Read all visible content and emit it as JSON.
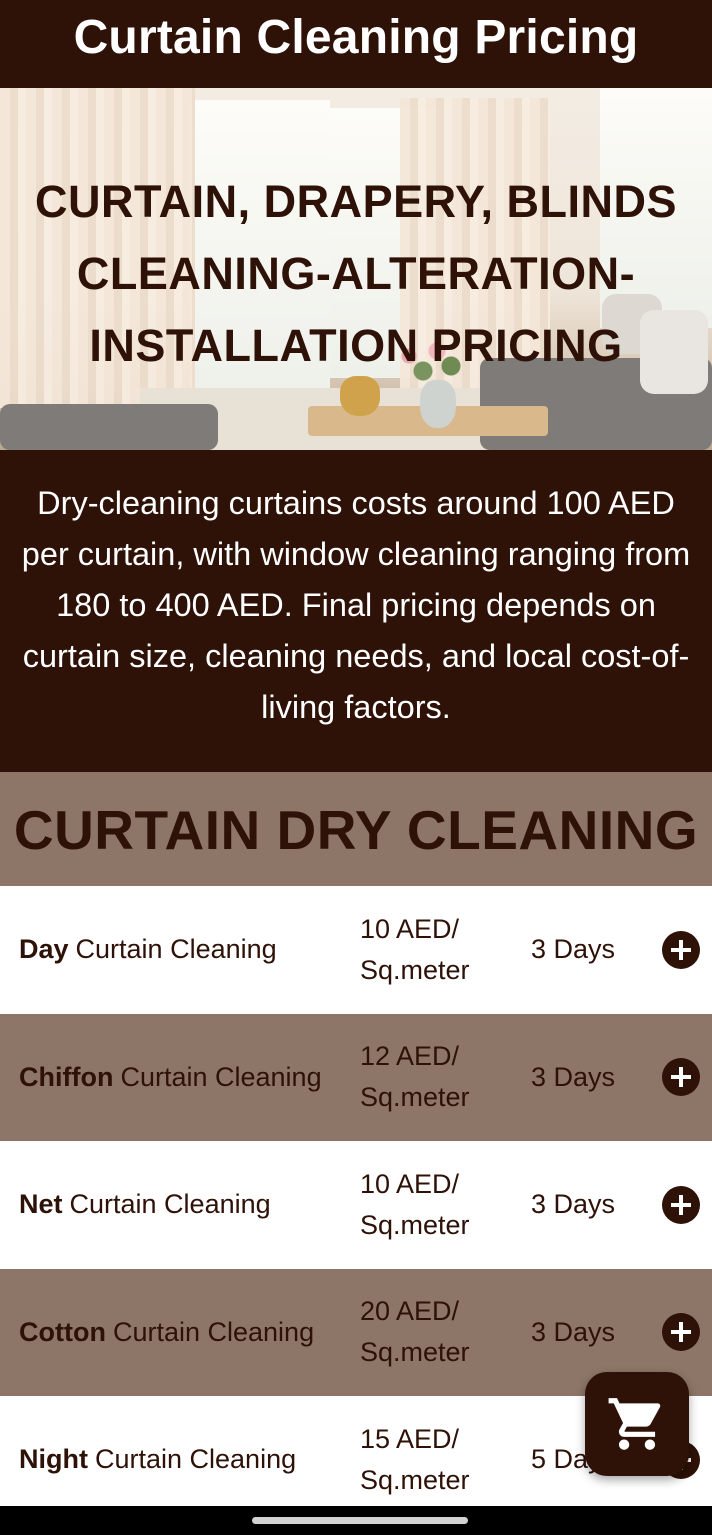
{
  "header": {
    "title": "Curtain Cleaning Pricing"
  },
  "hero": {
    "title": "CURTAIN, DRAPERY, BLINDS CLEANING-ALTERATION-INSTALLATION PRICING"
  },
  "intro": {
    "text": "Dry-cleaning curtains costs around 100 AED per curtain, with window cleaning ranging from 180 to 400 AED. Final pricing depends on curtain size, cleaning needs, and local cost-of-living factors."
  },
  "section": {
    "title": "CURTAIN DRY CLEANING"
  },
  "services": [
    {
      "type": "Day",
      "label": "Curtain Cleaning",
      "price_amount": "10 AED/",
      "price_unit": "Sq.meter",
      "duration": "3 Days"
    },
    {
      "type": "Chiffon",
      "label": "Curtain Cleaning",
      "price_amount": "12 AED/",
      "price_unit": "Sq.meter",
      "duration": "3 Days"
    },
    {
      "type": "Net",
      "label": "Curtain Cleaning",
      "price_amount": "10 AED/",
      "price_unit": "Sq.meter",
      "duration": "3 Days"
    },
    {
      "type": "Cotton",
      "label": "Curtain Cleaning",
      "price_amount": "20 AED/",
      "price_unit": "Sq.meter",
      "duration": "3 Days"
    },
    {
      "type": "Night",
      "label": "Curtain Cleaning",
      "price_amount": "15 AED/",
      "price_unit": "Sq.meter",
      "duration": "5 Days"
    }
  ],
  "icons": {
    "add": "plus-circle-icon",
    "cart": "shopping-cart-icon"
  },
  "colors": {
    "dark_brown": "#2e1107",
    "taupe": "#8d7667",
    "white": "#ffffff"
  }
}
